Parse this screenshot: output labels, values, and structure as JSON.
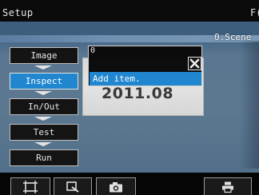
{
  "titlebar": {
    "title": "Setup",
    "right_text": "F("
  },
  "camera": {
    "scene_label": "0.Scene",
    "card_date": "2011.08"
  },
  "menu": {
    "items": [
      {
        "label": "Image",
        "active": false
      },
      {
        "label": "Inspect",
        "active": true
      },
      {
        "label": "In/Out",
        "active": false
      },
      {
        "label": "Test",
        "active": false
      },
      {
        "label": "Run",
        "active": false
      }
    ]
  },
  "popup": {
    "field_value": "0",
    "add_item_label": "Add item.",
    "close_icon": "close-icon"
  },
  "toolbar": {
    "buttons": [
      {
        "icon": "frame-icon"
      },
      {
        "icon": "zoom-icon"
      },
      {
        "icon": "camera-icon"
      },
      {
        "icon": "print-icon"
      }
    ]
  },
  "colors": {
    "accent": "#1f86cf",
    "background": "#0c0c0c",
    "border": "#bfbfbf"
  }
}
